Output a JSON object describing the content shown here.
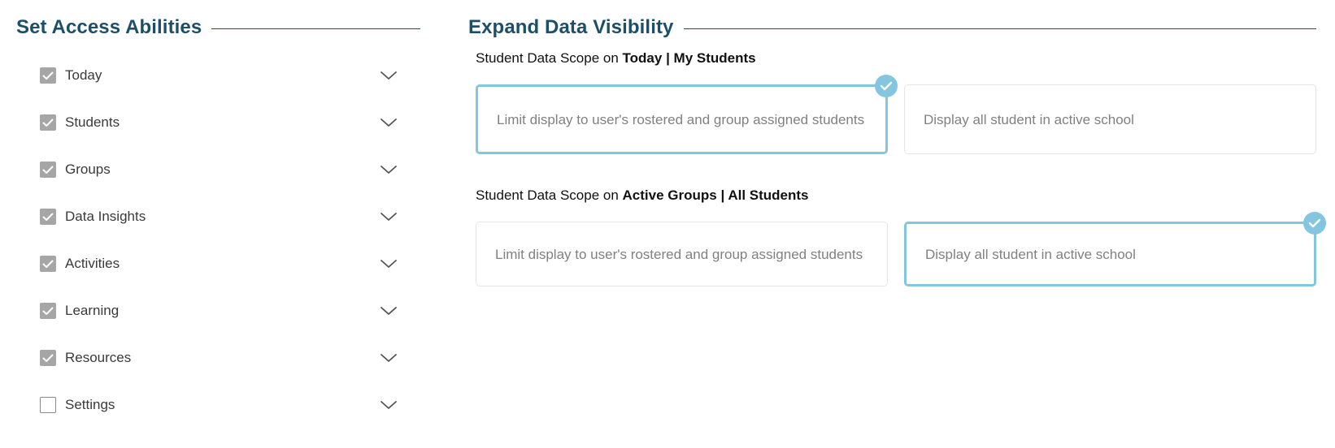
{
  "access_section": {
    "title": "Set Access Abilities",
    "items": [
      {
        "label": "Today",
        "checked": true
      },
      {
        "label": "Students",
        "checked": true
      },
      {
        "label": "Groups",
        "checked": true
      },
      {
        "label": "Data Insights",
        "checked": true
      },
      {
        "label": "Activities",
        "checked": true
      },
      {
        "label": "Learning",
        "checked": true
      },
      {
        "label": "Resources",
        "checked": true
      },
      {
        "label": "Settings",
        "checked": false
      }
    ]
  },
  "visibility_section": {
    "title": "Expand Data Visibility",
    "scopes": [
      {
        "prefix": "Student Data Scope on ",
        "context": "Today",
        "separator": " | ",
        "audience": "My Students",
        "options": [
          {
            "text": "Limit display to user's rostered and group assigned students",
            "selected": true
          },
          {
            "text": "Display all student in active school",
            "selected": false
          }
        ]
      },
      {
        "prefix": "Student Data Scope on ",
        "context": "Active Groups",
        "separator": " | ",
        "audience": "All Students",
        "options": [
          {
            "text": "Limit display to user's rostered and group assigned students",
            "selected": false
          },
          {
            "text": "Display all student in active school",
            "selected": true
          }
        ]
      }
    ]
  },
  "colors": {
    "heading": "#1d4f68",
    "selected_border": "#84c6e0",
    "checkbox_checked": "#a6a6a6",
    "option_text": "#808080"
  },
  "icons": {
    "checkbox_checked": "checkmark-icon",
    "expand": "chevron-down-icon",
    "selected_badge": "check-circle-icon"
  }
}
